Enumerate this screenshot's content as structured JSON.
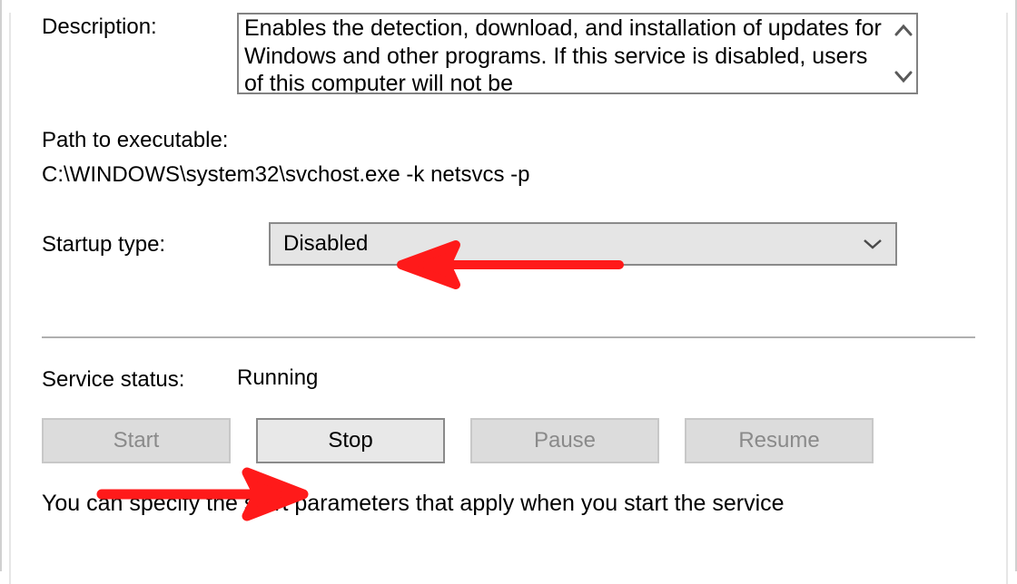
{
  "description": {
    "label": "Description:",
    "text": "Enables the detection, download, and installation of updates for Windows and other programs. If this service is disabled, users of this computer will not be"
  },
  "path": {
    "label": "Path to executable:",
    "value": "C:\\WINDOWS\\system32\\svchost.exe -k netsvcs -p"
  },
  "startup": {
    "label": "Startup type:",
    "selected": "Disabled"
  },
  "status": {
    "label": "Service status:",
    "value": "Running"
  },
  "buttons": {
    "start": "Start",
    "stop": "Stop",
    "pause": "Pause",
    "resume": "Resume"
  },
  "hint": "You can specify the start parameters that apply when you start the service"
}
